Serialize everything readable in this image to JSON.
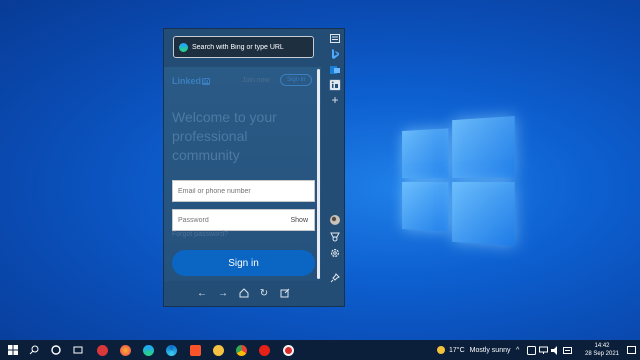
{
  "browser": {
    "address_placeholder": "Search with Bing or type URL"
  },
  "linkedin": {
    "logo_text": "Linked",
    "logo_box": "in",
    "join_now": "Join now",
    "sign_in_top": "Sign in",
    "welcome": "Welcome to your professional community",
    "email_placeholder": "Email or phone number",
    "password_placeholder": "Password",
    "show_label": "Show",
    "forgot": "Forgot password?",
    "sign_in_button": "Sign in"
  },
  "taskbar": {
    "weather_temp": "17°C",
    "weather_text": "Mostly sunny",
    "time": "14:42",
    "date": "28 Sep 2021"
  },
  "colors": {
    "linkedin_blue": "#0a66c2",
    "panel_bg": "#234d74",
    "desktop_blue": "#0d5fd0",
    "taskbar_bg": "#0b1f3a"
  }
}
